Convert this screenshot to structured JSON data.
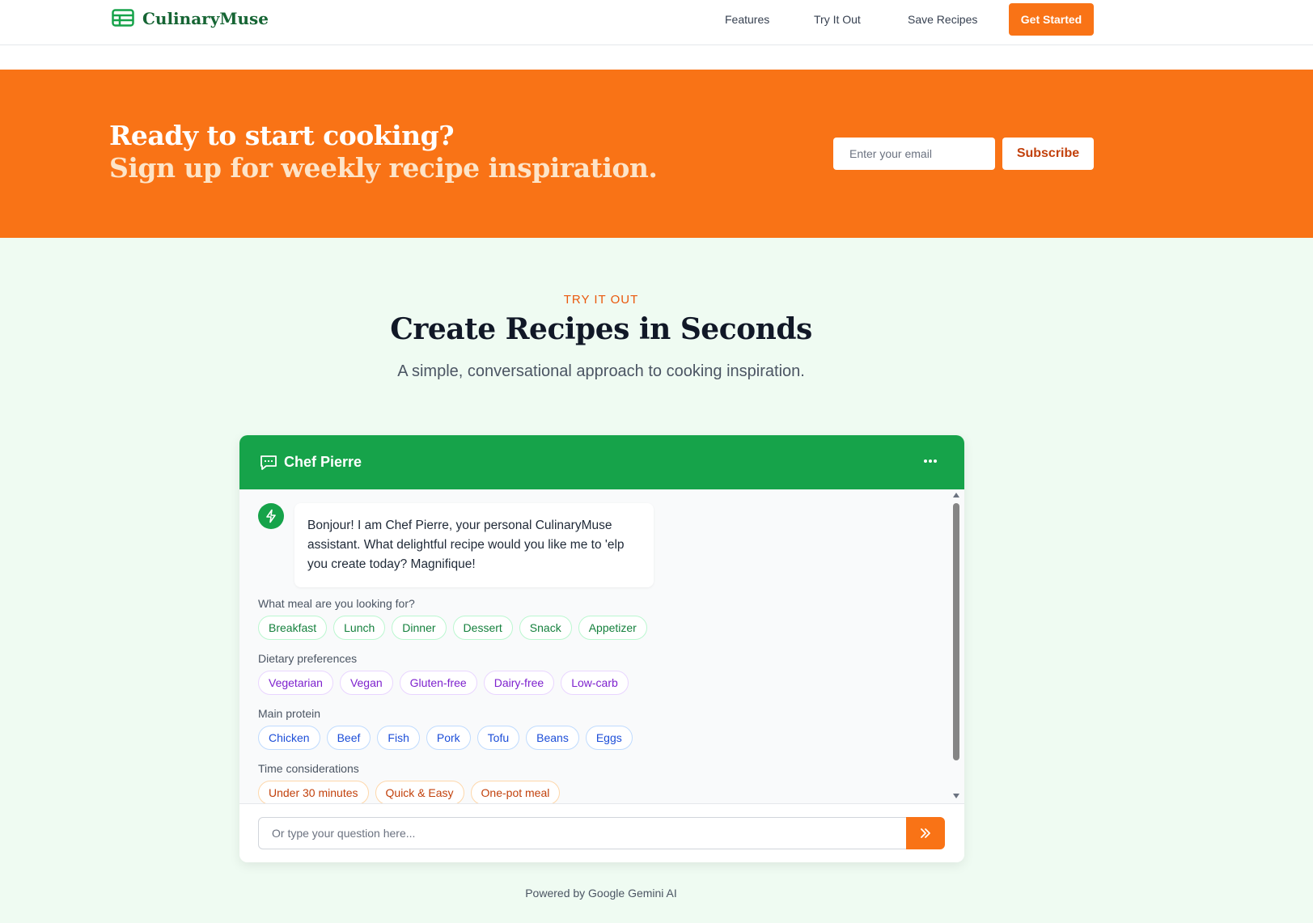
{
  "header": {
    "brand": "CulinaryMuse",
    "nav": [
      "Features",
      "Try It Out",
      "Save Recipes"
    ],
    "cta": "Get Started"
  },
  "newsletter": {
    "title_line1": "Ready to start cooking?",
    "title_line2": "Sign up for weekly recipe inspiration.",
    "email_placeholder": "Enter your email",
    "subscribe_label": "Subscribe"
  },
  "tryout": {
    "eyebrow": "TRY IT OUT",
    "title": "Create Recipes in Seconds",
    "subtitle": "A simple, conversational approach to cooking inspiration."
  },
  "chat": {
    "title": "Chef Pierre",
    "message": "Bonjour! I am Chef Pierre, your personal CulinaryMuse assistant. What delightful recipe would you like me to 'elp you create today? Magnifique!",
    "groups": {
      "meal": {
        "label": "What meal are you looking for?",
        "options": [
          "Breakfast",
          "Lunch",
          "Dinner",
          "Dessert",
          "Snack",
          "Appetizer"
        ]
      },
      "diet": {
        "label": "Dietary preferences",
        "options": [
          "Vegetarian",
          "Vegan",
          "Gluten-free",
          "Dairy-free",
          "Low-carb"
        ]
      },
      "protein": {
        "label": "Main protein",
        "options": [
          "Chicken",
          "Beef",
          "Fish",
          "Pork",
          "Tofu",
          "Beans",
          "Eggs"
        ]
      },
      "time": {
        "label": "Time considerations",
        "options": [
          "Under 30 minutes",
          "Quick & Easy",
          "One-pot meal"
        ]
      }
    },
    "input_placeholder": "Or type your question here..."
  },
  "footer": {
    "powered": "Powered by Google Gemini AI"
  },
  "colors": {
    "brand_green": "#16a34a",
    "accent_orange": "#f97316",
    "section_bg": "#effbf2"
  }
}
